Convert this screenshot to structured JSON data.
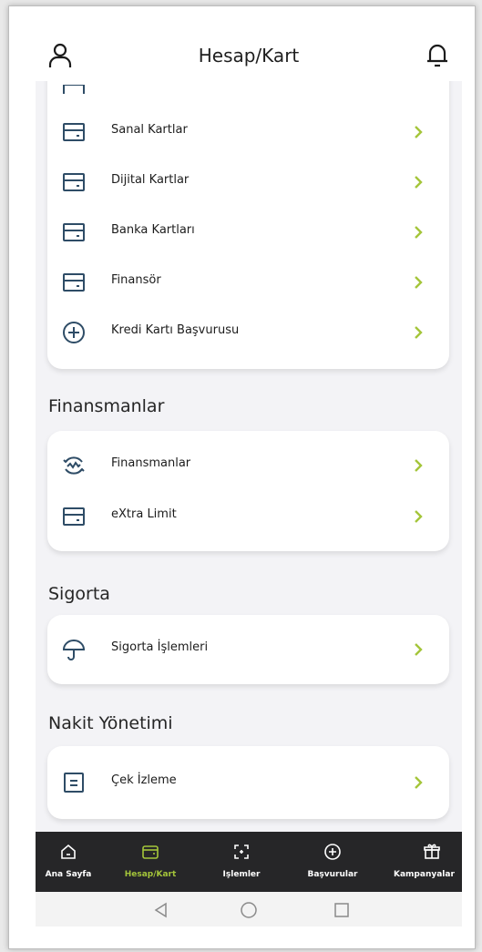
{
  "header": {
    "title": "Hesap/Kart",
    "profile_icon": "user-icon",
    "notification_icon": "bell-icon"
  },
  "cards_section": {
    "items": [
      {
        "label": "Sanal Kartlar",
        "icon": "card-icon"
      },
      {
        "label": "Dijital Kartlar",
        "icon": "card-icon"
      },
      {
        "label": "Banka Kartları",
        "icon": "card-icon"
      },
      {
        "label": "Finansör",
        "icon": "card-icon"
      },
      {
        "label": "Kredi Kartı Başvurusu",
        "icon": "plus-circle-icon"
      }
    ]
  },
  "finance_section": {
    "title": "Finansmanlar",
    "items": [
      {
        "label": "Finansmanlar",
        "icon": "wave-circle-icon"
      },
      {
        "label": "eXtra Limit",
        "icon": "card-icon"
      }
    ]
  },
  "insurance_section": {
    "title": "Sigorta",
    "items": [
      {
        "label": "Sigorta İşlemleri",
        "icon": "umbrella-icon"
      }
    ]
  },
  "cash_section": {
    "title": "Nakit Yönetimi",
    "items": [
      {
        "label": "Çek İzleme",
        "icon": "document-icon"
      }
    ]
  },
  "bottom_nav": {
    "items": [
      {
        "label": "Ana Sayfa",
        "icon": "home-icon"
      },
      {
        "label": "Hesap/Kart",
        "icon": "wallet-icon",
        "active": true
      },
      {
        "label": "İşlemler",
        "icon": "scan-icon"
      },
      {
        "label": "Başvurular",
        "icon": "plus-circle-icon"
      },
      {
        "label": "Kampanyalar",
        "icon": "gift-icon"
      }
    ]
  },
  "system_nav": {
    "items": [
      "back-icon",
      "home-circle-icon",
      "recents-icon"
    ]
  },
  "colors": {
    "accent": "#a4c53a",
    "icon_blue": "#2e4c66",
    "nav_bg": "#262628"
  }
}
